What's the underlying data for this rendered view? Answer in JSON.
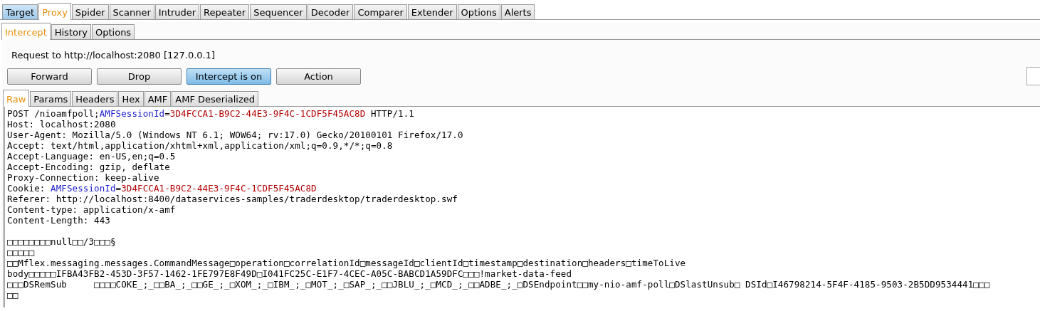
{
  "main_tabs": [
    {
      "label": "Target",
      "selected": false,
      "highlighted": true
    },
    {
      "label": "Proxy",
      "selected": true,
      "highlighted": false
    },
    {
      "label": "Spider",
      "selected": false,
      "highlighted": false
    },
    {
      "label": "Scanner",
      "selected": false,
      "highlighted": false
    },
    {
      "label": "Intruder",
      "selected": false,
      "highlighted": false
    },
    {
      "label": "Repeater",
      "selected": false,
      "highlighted": false
    },
    {
      "label": "Sequencer",
      "selected": false,
      "highlighted": false
    },
    {
      "label": "Decoder",
      "selected": false,
      "highlighted": false
    },
    {
      "label": "Comparer",
      "selected": false,
      "highlighted": false
    },
    {
      "label": "Extender",
      "selected": false,
      "highlighted": false
    },
    {
      "label": "Options",
      "selected": false,
      "highlighted": false
    },
    {
      "label": "Alerts",
      "selected": false,
      "highlighted": false
    }
  ],
  "sub_tabs": [
    {
      "label": "Intercept",
      "selected": true
    },
    {
      "label": "History",
      "selected": false
    },
    {
      "label": "Options",
      "selected": false
    }
  ],
  "request_label": "Request to http://localhost:2080  [127.0.0.1]",
  "buttons": [
    {
      "label": "Forward",
      "on": false
    },
    {
      "label": "Drop",
      "on": false
    },
    {
      "label": "Intercept is on",
      "on": true
    },
    {
      "label": "Action",
      "on": false
    }
  ],
  "view_tabs": [
    {
      "label": "Raw",
      "selected": true
    },
    {
      "label": "Params",
      "selected": false
    },
    {
      "label": "Headers",
      "selected": false
    },
    {
      "label": "Hex",
      "selected": false
    },
    {
      "label": "AMF",
      "selected": false
    },
    {
      "label": "AMF Deserialized",
      "selected": false
    }
  ],
  "message_lines": [
    [
      {
        "text": "POST /nioamfpoll;",
        "kind": "plain"
      },
      {
        "text": "AMFSessionId",
        "kind": "name"
      },
      {
        "text": "=",
        "kind": "plain"
      },
      {
        "text": "3D4FCCA1-B9C2-44E3-9F4C-1CDF5F45AC8D",
        "kind": "value"
      },
      {
        "text": " HTTP/1.1",
        "kind": "plain"
      }
    ],
    [
      {
        "text": "Host: localhost:2080",
        "kind": "plain"
      }
    ],
    [
      {
        "text": "User-Agent: Mozilla/5.0 (Windows NT 6.1; WOW64; rv:17.0) Gecko/20100101 Firefox/17.0",
        "kind": "plain"
      }
    ],
    [
      {
        "text": "Accept: text/html,application/xhtml+xml,application/xml;q=0.9,*/*;q=0.8",
        "kind": "plain"
      }
    ],
    [
      {
        "text": "Accept-Language: en-US,en;q=0.5",
        "kind": "plain"
      }
    ],
    [
      {
        "text": "Accept-Encoding: gzip, deflate",
        "kind": "plain"
      }
    ],
    [
      {
        "text": "Proxy-Connection: keep-alive",
        "kind": "plain"
      }
    ],
    [
      {
        "text": "Cookie: ",
        "kind": "plain"
      },
      {
        "text": "AMFSessionId",
        "kind": "name"
      },
      {
        "text": "=",
        "kind": "plain"
      },
      {
        "text": "3D4FCCA1-B9C2-44E3-9F4C-1CDF5F45AC8D",
        "kind": "value"
      }
    ],
    [
      {
        "text": "Referer: http://localhost:8400/dataservices-samples/traderdesktop/traderdesktop.swf",
        "kind": "plain"
      }
    ],
    [
      {
        "text": "Content-type: application/x-amf",
        "kind": "plain"
      }
    ],
    [
      {
        "text": "Content-Length: 443",
        "kind": "plain"
      }
    ],
    {
      "kind": "blank"
    },
    [
      {
        "text": "□□□□□□□□null□□/3□□□§",
        "kind": "plain"
      }
    ],
    [
      {
        "text": "□□□□□",
        "kind": "plain"
      }
    ],
    [
      {
        "text": "□□Mflex.messaging.messages.CommandMessage□operation□correlationId□messageId□clientId□timestamp□destination□headers□timeToLive",
        "kind": "plain"
      }
    ],
    [
      {
        "text": "body□□□□□IFBA43FB2-453D-3F57-1462-1FE797E8F49D□I041FC25C-E1F7-4CEC-A05C-BABCD1A59DFC□□□!market-data-feed",
        "kind": "plain"
      }
    ],
    [
      {
        "text": "□□□DSRemSub     □□□□COKE_;_□□BA_;_□□GE_;_□XOM_;_□IBM_;_□MOT_;_□SAP_;_□□JBLU_;_□MCD_;_□□ADBE_;_□DSEndpoint□□my-nio-amf-poll□DSlastUnsub□ DSId□I46798214-5F4F-4185-9503-2B5DD9534441□□□",
        "kind": "plain"
      }
    ],
    [
      {
        "text": "□□",
        "kind": "plain"
      }
    ]
  ]
}
